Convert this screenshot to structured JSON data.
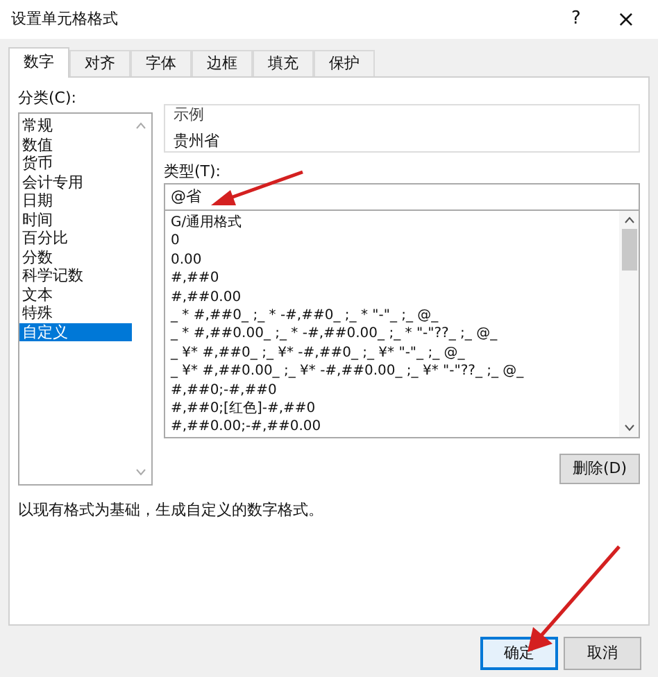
{
  "window": {
    "title": "设置单元格格式",
    "help": "?",
    "close": "×"
  },
  "tabs": [
    {
      "label": "数字",
      "selected": true
    },
    {
      "label": "对齐",
      "selected": false
    },
    {
      "label": "字体",
      "selected": false
    },
    {
      "label": "边框",
      "selected": false
    },
    {
      "label": "填充",
      "selected": false
    },
    {
      "label": "保护",
      "selected": false
    }
  ],
  "category": {
    "label": "分类(C):",
    "items": [
      {
        "label": "常规",
        "selected": false
      },
      {
        "label": "数值",
        "selected": false
      },
      {
        "label": "货币",
        "selected": false
      },
      {
        "label": "会计专用",
        "selected": false
      },
      {
        "label": "日期",
        "selected": false
      },
      {
        "label": "时间",
        "selected": false
      },
      {
        "label": "百分比",
        "selected": false
      },
      {
        "label": "分数",
        "selected": false
      },
      {
        "label": "科学记数",
        "selected": false
      },
      {
        "label": "文本",
        "selected": false
      },
      {
        "label": "特殊",
        "selected": false
      },
      {
        "label": "自定义",
        "selected": true
      }
    ]
  },
  "sample": {
    "label": "示例",
    "value": "贵州省"
  },
  "type": {
    "label": "类型(T):",
    "value": "@省"
  },
  "formats": [
    "G/通用格式",
    "0",
    "0.00",
    "#,##0",
    "#,##0.00",
    "_ * #,##0_ ;_ * -#,##0_ ;_ * \"-\"_ ;_ @_",
    "_ * #,##0.00_ ;_ * -#,##0.00_ ;_ * \"-\"??_ ;_ @_",
    "_ ¥* #,##0_ ;_ ¥* -#,##0_ ;_ ¥* \"-\"_ ;_ @_",
    "_ ¥* #,##0.00_ ;_ ¥* -#,##0.00_ ;_ ¥* \"-\"??_ ;_ @_",
    "#,##0;-#,##0",
    "#,##0;[红色]-#,##0",
    "#,##0.00;-#,##0.00"
  ],
  "delete_button": "删除(D)",
  "description": "以现有格式为基础，生成自定义的数字格式。",
  "buttons": [
    {
      "label": "确定",
      "selected": true
    },
    {
      "label": "取消",
      "selected": false
    }
  ]
}
